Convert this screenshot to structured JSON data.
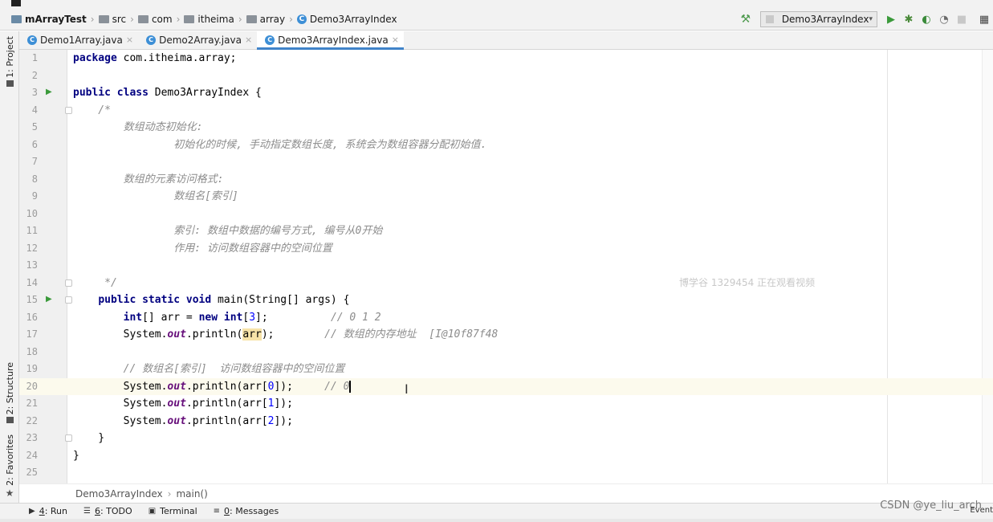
{
  "navbar": {
    "crumbs": [
      {
        "label": "mArrayTest",
        "bold": true
      },
      {
        "label": "src"
      },
      {
        "label": "com"
      },
      {
        "label": "itheima"
      },
      {
        "label": "array"
      },
      {
        "label": "Demo3ArrayIndex"
      }
    ],
    "run_config": "Demo3ArrayIndex",
    "icons": [
      "hammer-icon",
      "run-icon",
      "debug-icon",
      "coverage-icon",
      "profile-icon",
      "stop-icon",
      "project-structure-icon"
    ]
  },
  "left_strip": {
    "project": "1: Project",
    "structure": "2: Structure",
    "favorites": "2: Favorites"
  },
  "tabs": [
    {
      "label": "Demo1Array.java",
      "active": false
    },
    {
      "label": "Demo2Array.java",
      "active": false
    },
    {
      "label": "Demo3ArrayIndex.java",
      "active": true
    }
  ],
  "editor": {
    "lines": [
      {
        "n": "1"
      },
      {
        "n": "2"
      },
      {
        "n": "3"
      },
      {
        "n": "4"
      },
      {
        "n": "5"
      },
      {
        "n": "6"
      },
      {
        "n": "7"
      },
      {
        "n": "8"
      },
      {
        "n": "9"
      },
      {
        "n": "10"
      },
      {
        "n": "11"
      },
      {
        "n": "12"
      },
      {
        "n": "13"
      },
      {
        "n": "14"
      },
      {
        "n": "15"
      },
      {
        "n": "16"
      },
      {
        "n": "17"
      },
      {
        "n": "18"
      },
      {
        "n": "19"
      },
      {
        "n": "20"
      },
      {
        "n": "21"
      },
      {
        "n": "22"
      },
      {
        "n": "23"
      },
      {
        "n": "24"
      },
      {
        "n": "25"
      }
    ],
    "current_line": "20",
    "tokens": {
      "l1_kw": "package",
      "l1_rest": " com.itheima.array;",
      "l3_kw1": "public",
      "l3_kw2": "class",
      "l3_rest": " Demo3ArrayIndex {",
      "l4": "    /*",
      "l5": "        数组动态初始化:",
      "l6": "                初始化的时候, 手动指定数组长度, 系统会为数组容器分配初始值.",
      "l8": "        数组的元素访问格式:",
      "l9": "                数组名[索引]",
      "l11": "                索引: 数组中数据的编号方式, 编号从0开始",
      "l12": "                作用: 访问数组容器中的空间位置",
      "l14": "     */",
      "l15_kw": "public static void",
      "l15_rest": " main(String[] args) {",
      "l16_kw1": "int",
      "l16_mid": "[] arr = ",
      "l16_kw2": "new int",
      "l16_br1": "[",
      "l16_num": "3",
      "l16_br2": "];",
      "l16_cm": "          // 0 1 2",
      "l17_a": "System.",
      "l17_fld": "out",
      "l17_b": ".println(",
      "l17_hl": "arr",
      "l17_c": ");",
      "l17_cm": "        // 数组的内存地址  [I@10f87f48",
      "l19_cm": "        // 数组名[索引]  访问数组容器中的空间位置",
      "l20_a": "System.",
      "l20_fld": "out",
      "l20_b": ".println(arr[",
      "l20_num": "0",
      "l20_c": "]);",
      "l20_cm": "     // 0",
      "l21_a": "System.",
      "l21_fld": "out",
      "l21_b": ".println(arr[",
      "l21_num": "1",
      "l21_c": "]);",
      "l22_a": "System.",
      "l22_fld": "out",
      "l22_b": ".println(arr[",
      "l22_num": "2",
      "l22_c": "]);",
      "l23": "    }",
      "l24": "}"
    },
    "watermark": "博学谷 1329454 正在观看视频"
  },
  "editor_breadcrumbs": [
    "Demo3ArrayIndex",
    "main()"
  ],
  "bottom_tabs": [
    {
      "num": "4",
      "label": ": Run"
    },
    {
      "num": "6",
      "label": ": TODO"
    },
    {
      "num": "",
      "label": "Terminal"
    },
    {
      "num": "0",
      "label": ": Messages"
    }
  ],
  "csdn_watermark": "CSDN @ye_liu_arch",
  "event_log": "Event"
}
